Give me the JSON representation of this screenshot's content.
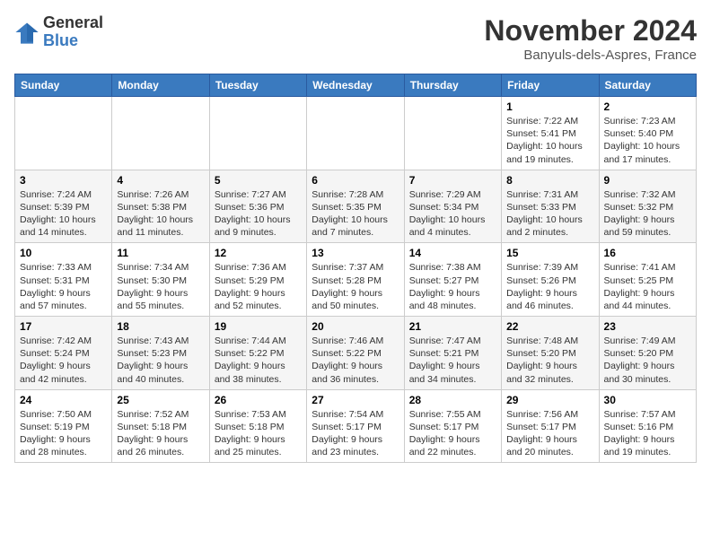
{
  "logo": {
    "line1": "General",
    "line2": "Blue"
  },
  "title": "November 2024",
  "location": "Banyuls-dels-Aspres, France",
  "days_of_week": [
    "Sunday",
    "Monday",
    "Tuesday",
    "Wednesday",
    "Thursday",
    "Friday",
    "Saturday"
  ],
  "weeks": [
    [
      {
        "day": "",
        "info": ""
      },
      {
        "day": "",
        "info": ""
      },
      {
        "day": "",
        "info": ""
      },
      {
        "day": "",
        "info": ""
      },
      {
        "day": "",
        "info": ""
      },
      {
        "day": "1",
        "info": "Sunrise: 7:22 AM\nSunset: 5:41 PM\nDaylight: 10 hours and 19 minutes."
      },
      {
        "day": "2",
        "info": "Sunrise: 7:23 AM\nSunset: 5:40 PM\nDaylight: 10 hours and 17 minutes."
      }
    ],
    [
      {
        "day": "3",
        "info": "Sunrise: 7:24 AM\nSunset: 5:39 PM\nDaylight: 10 hours and 14 minutes."
      },
      {
        "day": "4",
        "info": "Sunrise: 7:26 AM\nSunset: 5:38 PM\nDaylight: 10 hours and 11 minutes."
      },
      {
        "day": "5",
        "info": "Sunrise: 7:27 AM\nSunset: 5:36 PM\nDaylight: 10 hours and 9 minutes."
      },
      {
        "day": "6",
        "info": "Sunrise: 7:28 AM\nSunset: 5:35 PM\nDaylight: 10 hours and 7 minutes."
      },
      {
        "day": "7",
        "info": "Sunrise: 7:29 AM\nSunset: 5:34 PM\nDaylight: 10 hours and 4 minutes."
      },
      {
        "day": "8",
        "info": "Sunrise: 7:31 AM\nSunset: 5:33 PM\nDaylight: 10 hours and 2 minutes."
      },
      {
        "day": "9",
        "info": "Sunrise: 7:32 AM\nSunset: 5:32 PM\nDaylight: 9 hours and 59 minutes."
      }
    ],
    [
      {
        "day": "10",
        "info": "Sunrise: 7:33 AM\nSunset: 5:31 PM\nDaylight: 9 hours and 57 minutes."
      },
      {
        "day": "11",
        "info": "Sunrise: 7:34 AM\nSunset: 5:30 PM\nDaylight: 9 hours and 55 minutes."
      },
      {
        "day": "12",
        "info": "Sunrise: 7:36 AM\nSunset: 5:29 PM\nDaylight: 9 hours and 52 minutes."
      },
      {
        "day": "13",
        "info": "Sunrise: 7:37 AM\nSunset: 5:28 PM\nDaylight: 9 hours and 50 minutes."
      },
      {
        "day": "14",
        "info": "Sunrise: 7:38 AM\nSunset: 5:27 PM\nDaylight: 9 hours and 48 minutes."
      },
      {
        "day": "15",
        "info": "Sunrise: 7:39 AM\nSunset: 5:26 PM\nDaylight: 9 hours and 46 minutes."
      },
      {
        "day": "16",
        "info": "Sunrise: 7:41 AM\nSunset: 5:25 PM\nDaylight: 9 hours and 44 minutes."
      }
    ],
    [
      {
        "day": "17",
        "info": "Sunrise: 7:42 AM\nSunset: 5:24 PM\nDaylight: 9 hours and 42 minutes."
      },
      {
        "day": "18",
        "info": "Sunrise: 7:43 AM\nSunset: 5:23 PM\nDaylight: 9 hours and 40 minutes."
      },
      {
        "day": "19",
        "info": "Sunrise: 7:44 AM\nSunset: 5:22 PM\nDaylight: 9 hours and 38 minutes."
      },
      {
        "day": "20",
        "info": "Sunrise: 7:46 AM\nSunset: 5:22 PM\nDaylight: 9 hours and 36 minutes."
      },
      {
        "day": "21",
        "info": "Sunrise: 7:47 AM\nSunset: 5:21 PM\nDaylight: 9 hours and 34 minutes."
      },
      {
        "day": "22",
        "info": "Sunrise: 7:48 AM\nSunset: 5:20 PM\nDaylight: 9 hours and 32 minutes."
      },
      {
        "day": "23",
        "info": "Sunrise: 7:49 AM\nSunset: 5:20 PM\nDaylight: 9 hours and 30 minutes."
      }
    ],
    [
      {
        "day": "24",
        "info": "Sunrise: 7:50 AM\nSunset: 5:19 PM\nDaylight: 9 hours and 28 minutes."
      },
      {
        "day": "25",
        "info": "Sunrise: 7:52 AM\nSunset: 5:18 PM\nDaylight: 9 hours and 26 minutes."
      },
      {
        "day": "26",
        "info": "Sunrise: 7:53 AM\nSunset: 5:18 PM\nDaylight: 9 hours and 25 minutes."
      },
      {
        "day": "27",
        "info": "Sunrise: 7:54 AM\nSunset: 5:17 PM\nDaylight: 9 hours and 23 minutes."
      },
      {
        "day": "28",
        "info": "Sunrise: 7:55 AM\nSunset: 5:17 PM\nDaylight: 9 hours and 22 minutes."
      },
      {
        "day": "29",
        "info": "Sunrise: 7:56 AM\nSunset: 5:17 PM\nDaylight: 9 hours and 20 minutes."
      },
      {
        "day": "30",
        "info": "Sunrise: 7:57 AM\nSunset: 5:16 PM\nDaylight: 9 hours and 19 minutes."
      }
    ]
  ]
}
